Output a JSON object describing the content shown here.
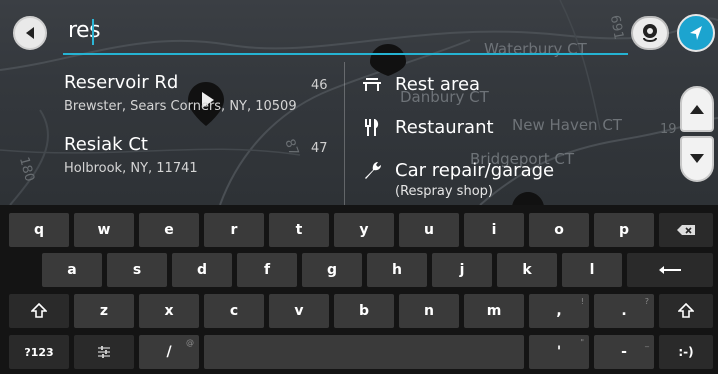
{
  "search": {
    "query": "res"
  },
  "map_labels": {
    "waterbury": "Waterbury CT",
    "danbury": "Danbury CT",
    "new_haven": "New Haven CT",
    "bridgeport": "Bridgeport CT",
    "route_87": "87",
    "route_180": "180",
    "route_691": "691",
    "route_19": "19"
  },
  "results": [
    {
      "title": "Reservoir Rd",
      "subtitle": "Brewster, Sears Corners, NY, 10509",
      "distance": "46"
    },
    {
      "title": "Resiak Ct",
      "subtitle": "Holbrook, NY, 11741",
      "distance": "47"
    }
  ],
  "categories": [
    {
      "label": "Rest area",
      "icon": "rest-area-icon"
    },
    {
      "label": "Restaurant",
      "icon": "restaurant-icon"
    },
    {
      "label": "Car repair/garage",
      "icon": "wrench-icon",
      "subtitle": "(Respray shop)"
    }
  ],
  "keyboard": {
    "row1": [
      {
        "label": "q",
        "hint": ""
      },
      {
        "label": "w",
        "hint": ""
      },
      {
        "label": "e",
        "hint": ""
      },
      {
        "label": "r",
        "hint": ""
      },
      {
        "label": "t",
        "hint": ""
      },
      {
        "label": "y",
        "hint": ""
      },
      {
        "label": "u",
        "hint": ""
      },
      {
        "label": "i",
        "hint": ""
      },
      {
        "label": "o",
        "hint": ""
      },
      {
        "label": "p",
        "hint": ""
      }
    ],
    "row2": [
      {
        "label": "a"
      },
      {
        "label": "s"
      },
      {
        "label": "d"
      },
      {
        "label": "f"
      },
      {
        "label": "g"
      },
      {
        "label": "h"
      },
      {
        "label": "j"
      },
      {
        "label": "k"
      },
      {
        "label": "l"
      }
    ],
    "row3": [
      {
        "label": "z"
      },
      {
        "label": "x"
      },
      {
        "label": "c"
      },
      {
        "label": "v"
      },
      {
        "label": "b"
      },
      {
        "label": "n"
      },
      {
        "label": "m"
      },
      {
        "label": ","
      },
      {
        "label": "."
      }
    ],
    "hints_row3": {
      "comma": "!",
      "period": "?"
    },
    "row4": {
      "symbols": "?123",
      "settings": "⚟",
      "slash": "/",
      "apostrophe": "'",
      "dash": "-",
      "smiley": ":-)"
    },
    "hints_row4": {
      "slash": "@",
      "apostrophe": "\"",
      "dash": "_"
    }
  },
  "colors": {
    "accent": "#1ca4cf",
    "keyboard_bg": "#141414",
    "key_bg": "#3a3a3a"
  }
}
